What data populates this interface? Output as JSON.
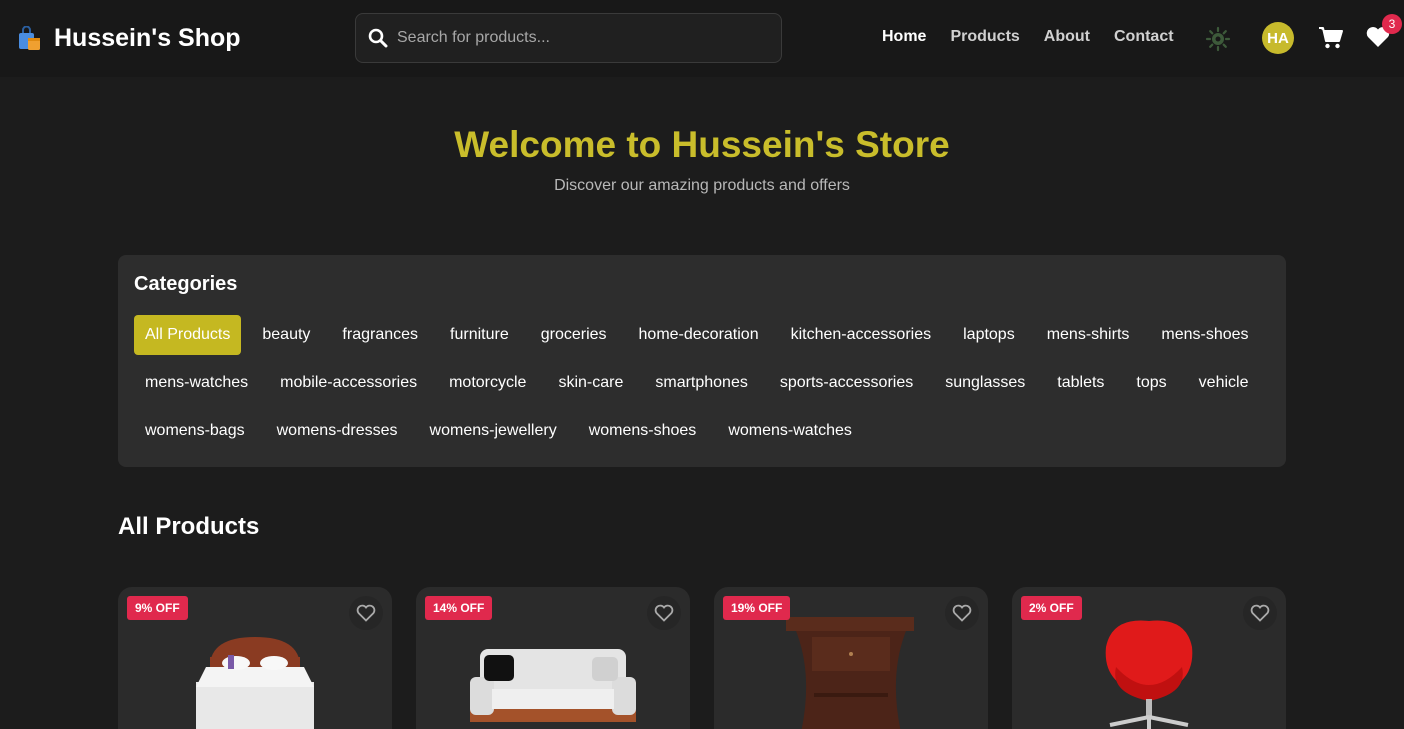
{
  "navbar": {
    "brand": "Hussein's Shop",
    "brand_icon": "shopping-bag-icon",
    "search_placeholder": "Search for products...",
    "links": [
      "Home",
      "Products",
      "About",
      "Contact"
    ],
    "active_link": "Home",
    "avatar_initials": "HA",
    "wishlist_count": "3"
  },
  "hero": {
    "title": "Welcome to Hussein's Store",
    "subtitle": "Discover our amazing products and offers"
  },
  "categories": {
    "title": "Categories",
    "items": [
      "All Products",
      "beauty",
      "fragrances",
      "furniture",
      "groceries",
      "home-decoration",
      "kitchen-accessories",
      "laptops",
      "mens-shirts",
      "mens-shoes",
      "mens-watches",
      "mobile-accessories",
      "motorcycle",
      "skin-care",
      "smartphones",
      "sports-accessories",
      "sunglasses",
      "tablets",
      "tops",
      "vehicle",
      "womens-bags",
      "womens-dresses",
      "womens-jewellery",
      "womens-shoes",
      "womens-watches"
    ],
    "active": "All Products"
  },
  "products_section": {
    "title": "All Products",
    "products": [
      {
        "discount": "9% OFF",
        "image": "bed"
      },
      {
        "discount": "14% OFF",
        "image": "sofa"
      },
      {
        "discount": "19% OFF",
        "image": "bedside-table"
      },
      {
        "discount": "2% OFF",
        "image": "office-chair"
      }
    ]
  },
  "colors": {
    "accent": "#c5b821",
    "badge": "#e0294d",
    "background": "#1c1c1c",
    "card": "#2d2d2d"
  }
}
